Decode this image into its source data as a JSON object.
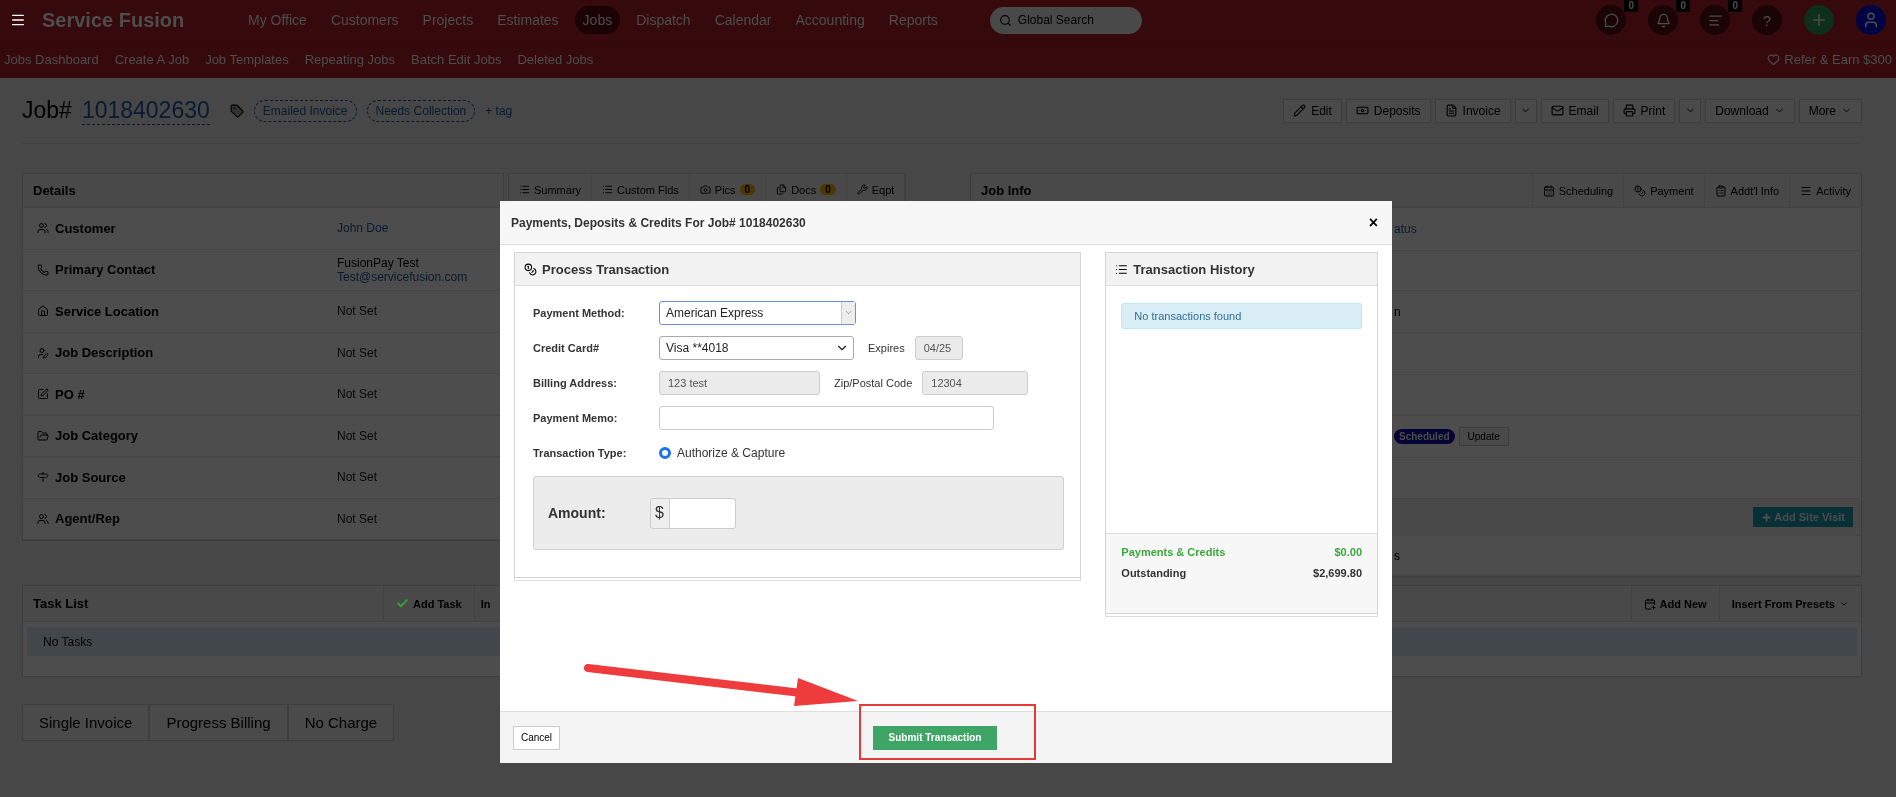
{
  "app": {
    "name": "Service Fusion"
  },
  "nav": [
    {
      "label": "My Office",
      "selected": false
    },
    {
      "label": "Customers",
      "selected": false
    },
    {
      "label": "Projects",
      "selected": false
    },
    {
      "label": "Estimates",
      "selected": false
    },
    {
      "label": "Jobs",
      "selected": true
    },
    {
      "label": "Dispatch",
      "selected": false
    },
    {
      "label": "Calendar",
      "selected": false
    },
    {
      "label": "Accounting",
      "selected": false
    },
    {
      "label": "Reports",
      "selected": false
    }
  ],
  "search": {
    "placeholder": "Global Search"
  },
  "header_icons": [
    {
      "kind": "chat",
      "count": "0"
    },
    {
      "kind": "bell",
      "count": "0"
    },
    {
      "kind": "list",
      "count": "0"
    },
    {
      "kind": "help",
      "label": "?"
    },
    {
      "kind": "add"
    },
    {
      "kind": "avatar"
    }
  ],
  "subnav": [
    "Jobs Dashboard",
    "Create A Job",
    "Job Templates",
    "Repeating Jobs",
    "Batch Edit Jobs",
    "Deleted Jobs"
  ],
  "refer": "Refer & Earn $300",
  "job": {
    "prefix": "Job#",
    "number": "1018402630",
    "tags": [
      "Emailed Invoice",
      "Needs Collection"
    ],
    "add_tag": "+ tag"
  },
  "actions": [
    {
      "label": "Edit",
      "kind": "plain"
    },
    {
      "label": "Deposits",
      "kind": "plain"
    },
    {
      "label": "Invoice",
      "kind": "split"
    },
    {
      "label": "Email",
      "kind": "plain"
    },
    {
      "label": "Print",
      "kind": "split"
    },
    {
      "label": "Download",
      "kind": "dropdown"
    },
    {
      "label": "More",
      "kind": "dropdown"
    }
  ],
  "details": {
    "title": "Details",
    "rows": [
      {
        "label": "Customer",
        "kind": "link",
        "value": "John Doe"
      },
      {
        "label": "Primary Contact",
        "kind": "contact",
        "value": "FusionPay Test",
        "link": "Test@servicefusion.com"
      },
      {
        "label": "Service Location",
        "kind": "muted",
        "value": "Not Set"
      },
      {
        "label": "Job Description",
        "kind": "muted",
        "value": "Not Set"
      },
      {
        "label": "PO #",
        "kind": "muted",
        "value": "Not Set"
      },
      {
        "label": "Job Category",
        "kind": "muted",
        "value": "Not Set"
      },
      {
        "label": "Job Source",
        "kind": "muted",
        "value": "Not Set"
      },
      {
        "label": "Agent/Rep",
        "kind": "muted",
        "value": "Not Set"
      }
    ]
  },
  "detail_tabs": [
    {
      "label": "Summary"
    },
    {
      "label": "Custom Flds"
    },
    {
      "label": "Pics",
      "count": "0"
    },
    {
      "label": "Docs",
      "count": "0"
    },
    {
      "label": "Eqpt"
    }
  ],
  "job_info": {
    "title": "Job Info",
    "tabs": [
      "Scheduling",
      "Payment",
      "Addt'l Info",
      "Activity"
    ],
    "rows": [
      {
        "kind": "link",
        "text": "atus"
      },
      {
        "kind": "empty"
      },
      {
        "kind": "text",
        "text": "n"
      },
      {
        "kind": "empty"
      },
      {
        "kind": "empty"
      },
      {
        "kind": "status",
        "badge": "Scheduled",
        "button": "Update"
      },
      {
        "kind": "empty"
      },
      {
        "kind": "section",
        "button": "Add Site Visit"
      },
      {
        "kind": "text",
        "text": "s"
      }
    ]
  },
  "task_list": {
    "title": "Task List",
    "actions": [
      "Add Task",
      "In"
    ],
    "right_actions": [
      "Add New",
      "Insert From Presets"
    ],
    "empty": "No Tasks"
  },
  "billing_tabs": [
    "Single Invoice",
    "Progress Billing",
    "No Charge"
  ],
  "modal": {
    "title": "Payments, Deposits & Credits For Job# 1018402630",
    "close": "×",
    "process": {
      "title": "Process Transaction",
      "payment_method": {
        "label": "Payment Method:",
        "value": "American Express"
      },
      "credit_card": {
        "label": "Credit Card#",
        "value": "Visa **4018"
      },
      "expires": {
        "label": "Expires",
        "value": "04/25"
      },
      "billing_address": {
        "label": "Billing Address:",
        "value": "123 test"
      },
      "zip": {
        "label": "Zip/Postal Code",
        "value": "12304"
      },
      "memo": {
        "label": "Payment Memo:"
      },
      "transaction_type": {
        "label": "Transaction Type:",
        "options": [
          {
            "label": "Authorize & Capture",
            "selected": true
          }
        ]
      },
      "amount": {
        "label": "Amount:",
        "currency": "$"
      }
    },
    "history": {
      "title": "Transaction History",
      "empty": "No transactions found",
      "payments_label": "Payments & Credits",
      "payments_value": "$0.00",
      "outstanding_label": "Outstanding",
      "outstanding_value": "$2,699.80"
    },
    "cancel": "Cancel",
    "submit": "Submit Transaction"
  },
  "annotation": {
    "kind": "arrow-box"
  }
}
